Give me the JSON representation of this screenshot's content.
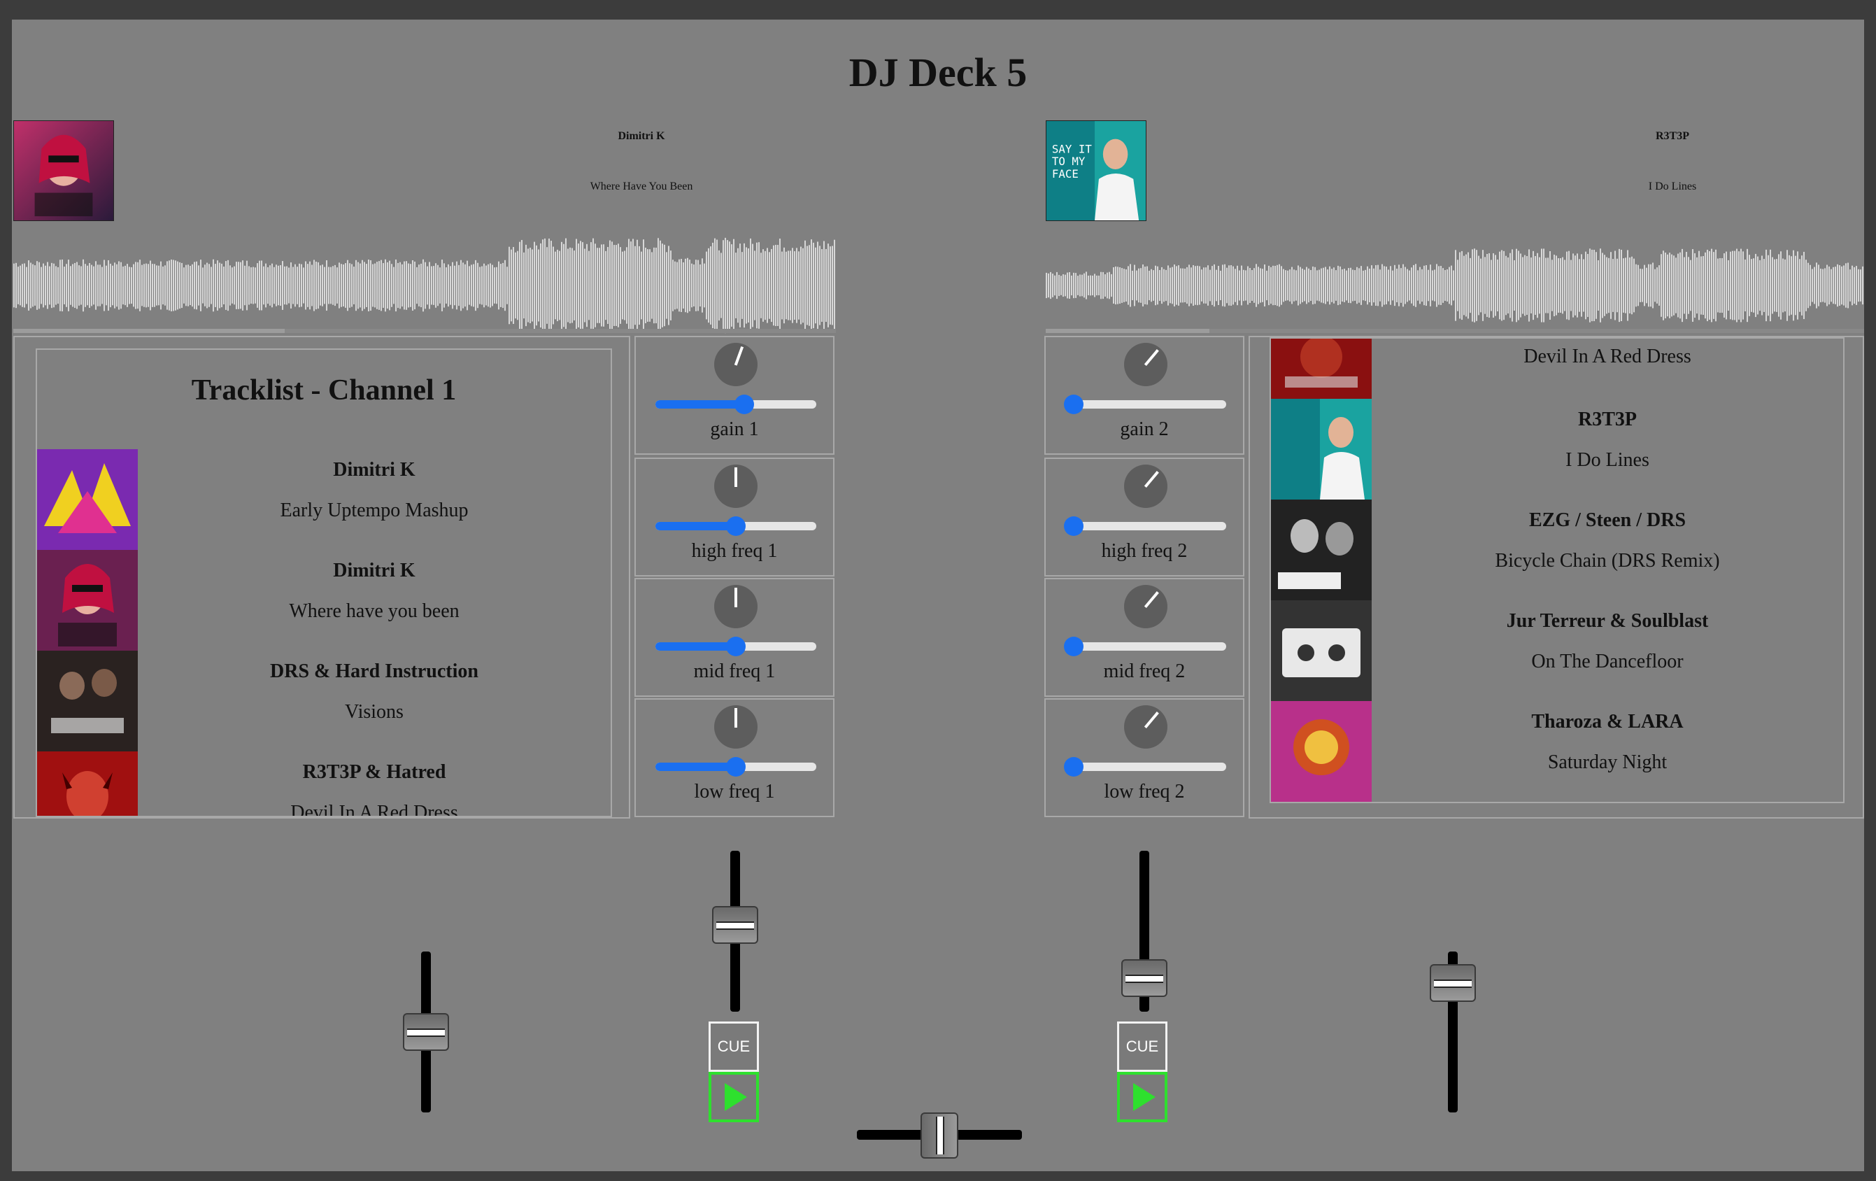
{
  "app": {
    "title": "DJ Deck 5"
  },
  "deck1": {
    "artist": "Dimitri K",
    "title": "Where Have You Been",
    "progress": 0.33,
    "cue_label": "CUE",
    "eq": [
      {
        "label": "gain 1",
        "value": 0.55
      },
      {
        "label": "high freq 1",
        "value": 0.5
      },
      {
        "label": "mid freq 1",
        "value": 0.5
      },
      {
        "label": "low freq 1",
        "value": 0.5
      }
    ],
    "knob_angles": [
      20,
      0,
      0,
      0
    ],
    "volume_level": 0.55
  },
  "deck2": {
    "artist": "R3T3P",
    "title": "I Do Lines",
    "progress": 0.2,
    "cue_label": "CUE",
    "eq": [
      {
        "label": "gain 2",
        "value": 0.0
      },
      {
        "label": "high freq 2",
        "value": 0.0
      },
      {
        "label": "mid freq 2",
        "value": 0.0
      },
      {
        "label": "low freq 2",
        "value": 0.0
      }
    ],
    "knob_angles": [
      40,
      40,
      40,
      40
    ],
    "volume_level": 0.12
  },
  "tracklist1": {
    "heading": "Tracklist - Channel 1",
    "tracks": [
      {
        "artist": "Dimitri K",
        "title": "Early Uptempo Mashup",
        "art": "purple-mashup-art"
      },
      {
        "artist": "Dimitri K",
        "title": "Where have you been",
        "art": "where-have-you-been-art"
      },
      {
        "artist": "DRS & Hard Instruction",
        "title": "Visions",
        "art": "visions-art"
      },
      {
        "artist": "R3T3P & Hatred",
        "title": "Devil In A Red Dress",
        "art": "devil-red-art"
      }
    ]
  },
  "tracklist2": {
    "first_partial_title": "Devil In A Red Dress",
    "tracks": [
      {
        "artist": "R3T3P",
        "title": "I Do Lines",
        "art": "i-do-lines-art"
      },
      {
        "artist": "EZG / Steen / DRS",
        "title": "Bicycle Chain (DRS Remix)",
        "art": "bicycle-chain-art"
      },
      {
        "artist": "Jur Terreur & Soulblast",
        "title": "On The Dancefloor",
        "art": "cassette-art"
      },
      {
        "artist": "Tharoza & LARA",
        "title": "Saturday Night",
        "art": "saturday-night-art"
      }
    ]
  },
  "mixer": {
    "channel1_fader": 0.5,
    "channel2_fader": 0.9,
    "crossfader": 0.5
  },
  "colors": {
    "accent": "#1a6ff0",
    "play": "#2ee02e",
    "background": "#808080"
  }
}
